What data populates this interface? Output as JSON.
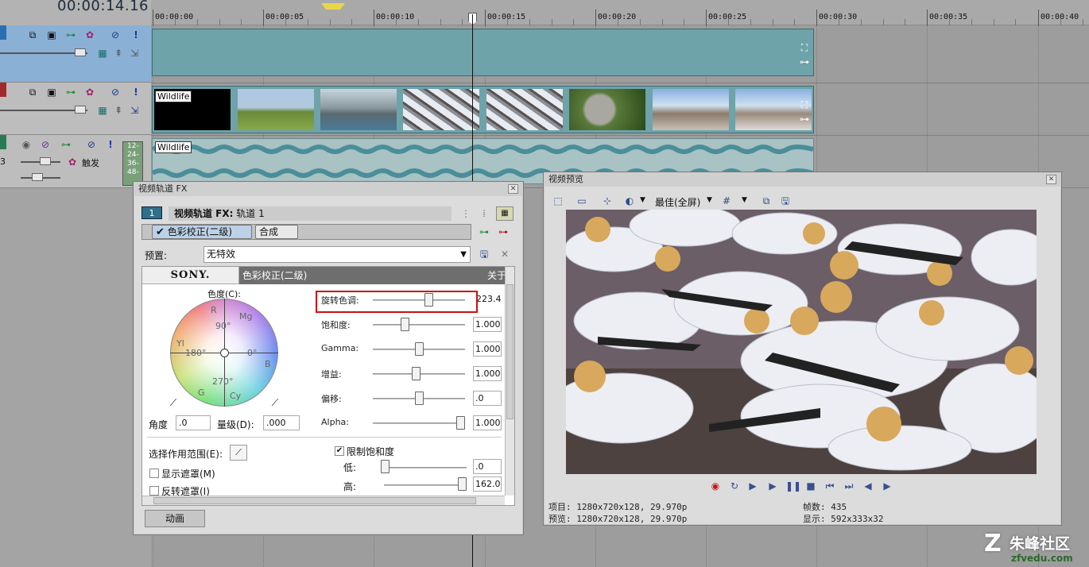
{
  "timeline": {
    "timecode": "00:00:14.16",
    "ruler_labels": [
      "00:00:00",
      "00:00:05",
      "00:00:10",
      "00:00:15",
      "00:00:20",
      "00:00:25",
      "00:00:30",
      "00:00:35",
      "00:00:40"
    ],
    "clip_label_video": "Wildlife",
    "clip_label_audio": "Wildlife",
    "audio_meter_labels": [
      "12-",
      "24-",
      "36-",
      "48-"
    ],
    "audio_touch_label": "触发",
    "audio_track_num": "3"
  },
  "fx_window": {
    "title": "视频轨道 FX",
    "track_num": "1",
    "header_label": "视频轨道 FX:",
    "header_track": "轨道 1",
    "chain": [
      "色彩校正(二级)",
      "合成"
    ],
    "preset_label": "预置:",
    "preset_value": "无特效",
    "brand": "SONY.",
    "plugin_title": "色彩校正(二级)",
    "about_label": "关于",
    "wheel": {
      "label": "色度(C):",
      "R": "R",
      "Mg": "Mg",
      "Yl": "Yl",
      "B": "B",
      "G": "G",
      "Cy": "Cy",
      "deg90": "90°",
      "deg180": "180°",
      "deg0": "0°",
      "deg270": "270°"
    },
    "angle_label": "角度",
    "angle_value": ".0",
    "magnitude_label": "量级(D):",
    "magnitude_value": ".000",
    "params": [
      {
        "label": "旋转色调:",
        "value": "223.4",
        "level": 0.62
      },
      {
        "label": "饱和度:",
        "value": "1.000",
        "level": 0.33
      },
      {
        "label": "Gamma:",
        "value": "1.000",
        "level": 0.5
      },
      {
        "label": "增益:",
        "value": "1.000",
        "level": 0.47
      },
      {
        "label": "偏移:",
        "value": ".0",
        "level": 0.5
      },
      {
        "label": "Alpha:",
        "value": "1.000",
        "level": 1.0
      }
    ],
    "select_range_label": "选择作用范围(E):",
    "show_mask_label": "显示遮罩(M)",
    "invert_mask_label": "反转遮罩(I)",
    "limit_sat_label": "限制饱和度",
    "low_label": "低:",
    "low_value": ".0",
    "low_level": 0.0,
    "high_label": "高:",
    "high_value": "162.0",
    "high_level": 1.0,
    "animate_label": "动画",
    "highlight_color": "#cc1111"
  },
  "preview": {
    "title": "视频预览",
    "quality_label": "最佳(全屏)",
    "project_info": "项目: 1280x720x128, 29.970p",
    "preview_info": "预览: 1280x720x128, 29.970p",
    "frame_info": "帧数: 435",
    "display_info": "显示: 592x333x32"
  },
  "watermark": {
    "brand": "朱峰社区",
    "url": "zfvedu.com"
  },
  "colors": {
    "video_event": "#6da3a9",
    "selected_track": "#8ab0d5",
    "highlight": "#cc1111"
  }
}
